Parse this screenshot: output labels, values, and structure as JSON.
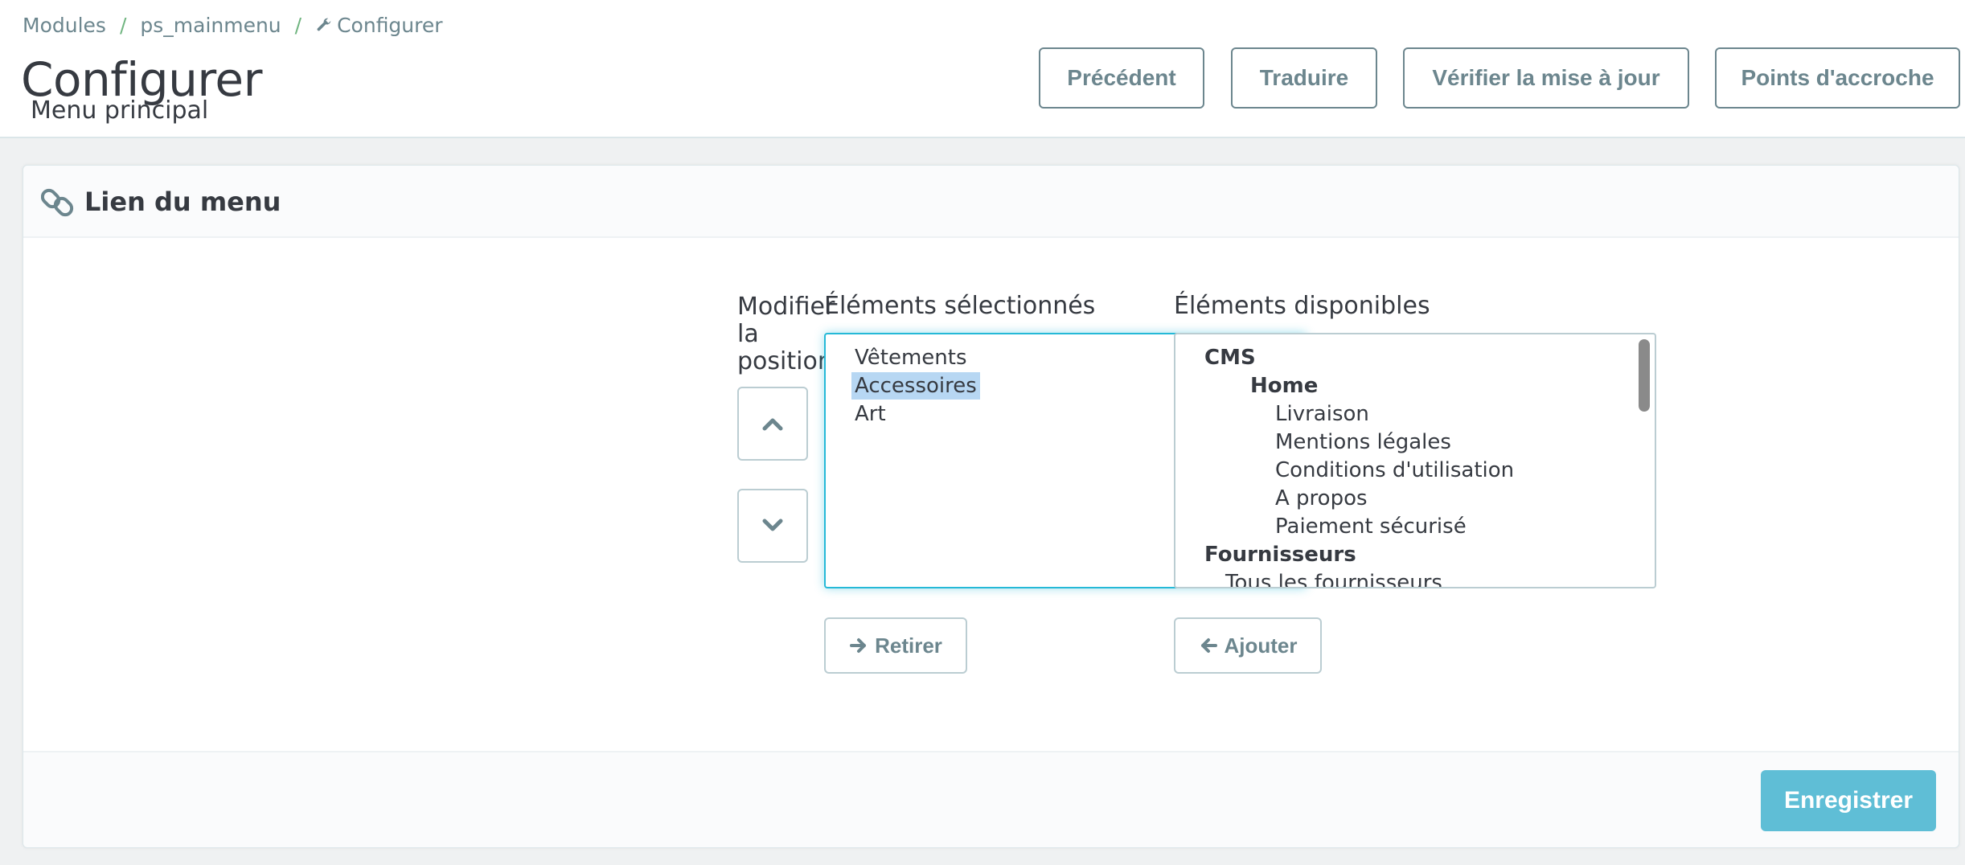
{
  "breadcrumb": {
    "items": [
      "Modules",
      "ps_mainmenu",
      "Configurer"
    ],
    "separator": "/"
  },
  "header": {
    "title": "Configurer",
    "subtitle": "Menu principal",
    "buttons": {
      "previous": "Précédent",
      "translate": "Traduire",
      "check_update": "Vérifier la mise à jour",
      "hooks": "Points d'accroche"
    }
  },
  "panel": {
    "title": "Lien du menu",
    "position_label": "Modifier la position",
    "selected_label": "Éléments sélectionnés",
    "available_label": "Éléments disponibles",
    "selected_items": [
      "Vêtements",
      "Accessoires",
      "Art"
    ],
    "selected_highlight": "Accessoires",
    "available_items": {
      "cms_group": "CMS",
      "home_group": "Home",
      "cms_pages": [
        "Livraison",
        "Mentions légales",
        "Conditions d'utilisation",
        "A propos",
        "Paiement sécurisé"
      ],
      "suppliers_group": "Fournisseurs",
      "suppliers_first": "Tous les fournisseurs"
    },
    "remove_button": "Retirer",
    "add_button": "Ajouter",
    "save_button": "Enregistrer"
  },
  "icons": {
    "breadcrumb_configure": "wrench-icon",
    "panel": "link-icon",
    "move_up": "chevron-up-icon",
    "move_down": "chevron-down-icon",
    "remove": "arrow-right-icon",
    "add": "arrow-left-icon"
  },
  "colors": {
    "primary": "#25b9d7",
    "save": "#5fbed6",
    "text": "#363a41",
    "muted": "#6c868e",
    "selection": "#b7d7f3"
  }
}
